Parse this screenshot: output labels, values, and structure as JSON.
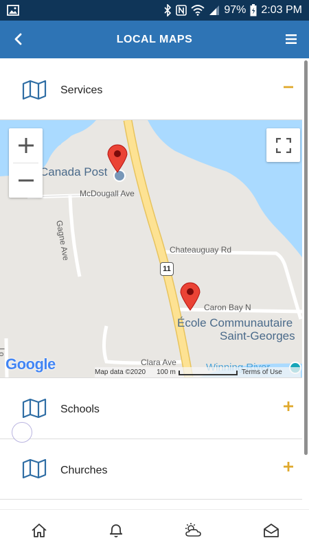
{
  "status_bar": {
    "battery": "97%",
    "time": "2:03 PM",
    "icons": [
      "image-icon",
      "bluetooth-icon",
      "nfc-icon",
      "wifi-icon",
      "signal-icon",
      "battery-icon"
    ]
  },
  "header": {
    "title": "LOCAL MAPS",
    "back_icon": "back-chevron-icon",
    "menu_icon": "hamburger-menu-icon"
  },
  "sections": [
    {
      "label": "Services",
      "expanded": true,
      "toggle_symbol": "−"
    },
    {
      "label": "Schools",
      "expanded": false,
      "toggle_symbol": "+"
    },
    {
      "label": "Churches",
      "expanded": false,
      "toggle_symbol": "+"
    }
  ],
  "map": {
    "places": {
      "canada_post": "Canada Post",
      "ecole_line1": "École Communautaire",
      "ecole_line2": "Saint-Georges",
      "winning_river": "Winning River"
    },
    "streets": {
      "mcdougall": "McDougall Ave",
      "gagne": "Gagne Ave",
      "chateauguay": "Chateauguay Rd",
      "caron_bay": "Caron Bay N",
      "clara": "Clara Ave",
      "lo_partial": "Lo"
    },
    "highway_shield": "11",
    "google_logo": "Google",
    "attribution": {
      "map_data": "Map data ©2020",
      "scale": "100 m",
      "terms": "Terms of Use"
    },
    "controls": {
      "zoom_in": "+",
      "zoom_out": "−"
    }
  },
  "bottom_nav": [
    {
      "icon": "home-icon"
    },
    {
      "icon": "bell-icon"
    },
    {
      "icon": "weather-icon"
    },
    {
      "icon": "mail-icon"
    }
  ],
  "colors": {
    "status_bar": "#0f3558",
    "header": "#2e74b5",
    "icon_blue": "#2e6da4",
    "toggle_gold": "#e0a92c",
    "water": "#aadaff",
    "land": "#e9e7e3",
    "highway": "#fde293",
    "pin": "#ea4335"
  }
}
